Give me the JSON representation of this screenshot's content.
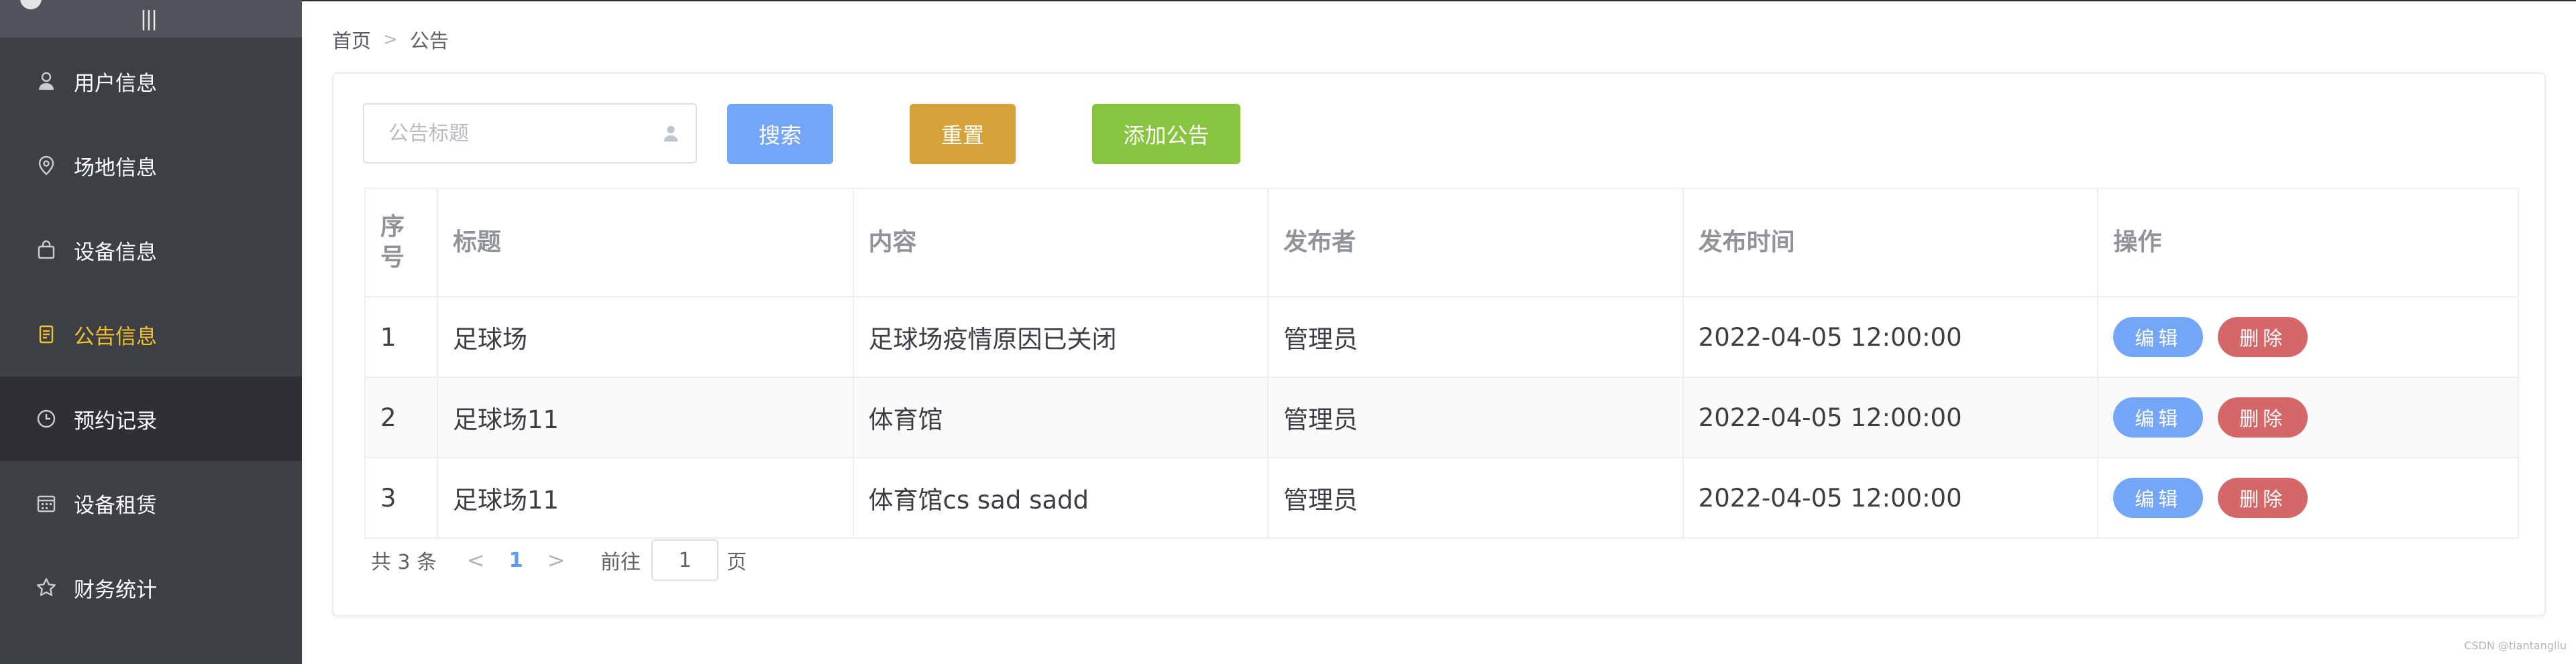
{
  "sidebar": {
    "collapse_icon": "|||",
    "items": [
      {
        "label": "用户信息",
        "icon": "user-icon"
      },
      {
        "label": "场地信息",
        "icon": "location-icon"
      },
      {
        "label": "设备信息",
        "icon": "bag-icon"
      },
      {
        "label": "公告信息",
        "icon": "document-icon"
      },
      {
        "label": "预约记录",
        "icon": "clock-icon"
      },
      {
        "label": "设备租赁",
        "icon": "calendar-icon"
      },
      {
        "label": "财务统计",
        "icon": "star-icon"
      }
    ],
    "active_label": "公告信息",
    "active_color": "#f3c12b"
  },
  "breadcrumb": {
    "home": "首页",
    "separator": ">",
    "current": "公告"
  },
  "toolbar": {
    "search_placeholder": "公告标题",
    "search_value": "",
    "search_label": "搜索",
    "reset_label": "重置",
    "add_label": "添加公告"
  },
  "table": {
    "headers": {
      "index": "序号",
      "title": "标题",
      "content": "内容",
      "author": "发布者",
      "time": "发布时间",
      "ops": "操作"
    },
    "rows": [
      {
        "index": "1",
        "title": "足球场",
        "content": "足球场疫情原因已关闭",
        "author": "管理员",
        "time": "2022-04-05 12:00:00",
        "edit": "编辑",
        "delete": "删除"
      },
      {
        "index": "2",
        "title": "足球场11",
        "content": "体育馆",
        "author": "管理员",
        "time": "2022-04-05 12:00:00",
        "edit": "编辑",
        "delete": "删除"
      },
      {
        "index": "3",
        "title": "足球场11",
        "content": "体育馆cs sad sadd",
        "author": "管理员",
        "time": "2022-04-05 12:00:00",
        "edit": "编辑",
        "delete": "删除"
      }
    ]
  },
  "pagination": {
    "total_text": "共 3 条",
    "prev": "<",
    "current_page": "1",
    "next": ">",
    "goto_label": "前往",
    "goto_value": "1",
    "goto_unit": "页"
  },
  "colors": {
    "sidebar_bg": "#3c3f44",
    "primary": "#74a6f7",
    "warning": "#d4a13b",
    "success": "#87c440",
    "danger": "#d46869"
  },
  "watermark": "CSDN @tiantangliu"
}
